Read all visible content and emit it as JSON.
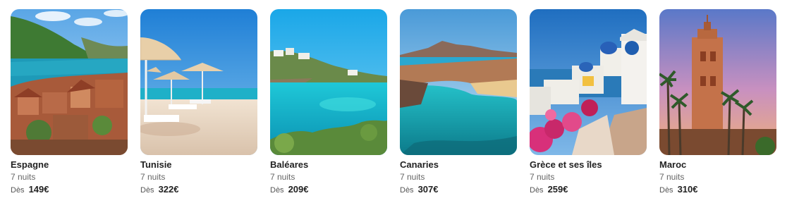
{
  "destinations": [
    {
      "name": "Espagne",
      "nights": "7 nuits",
      "from_label": "Dès",
      "price": "149€",
      "image": "spain-coast-photo"
    },
    {
      "name": "Tunisie",
      "nights": "7 nuits",
      "from_label": "Dès",
      "price": "322€",
      "image": "tunisia-beach-umbrellas-photo"
    },
    {
      "name": "Baléares",
      "nights": "7 nuits",
      "from_label": "Dès",
      "price": "209€",
      "image": "balearic-cove-photo"
    },
    {
      "name": "Canaries",
      "nights": "7 nuits",
      "from_label": "Dès",
      "price": "307€",
      "image": "canary-volcanic-bay-photo"
    },
    {
      "name": "Grèce et ses îles",
      "nights": "7 nuits",
      "from_label": "Dès",
      "price": "259€",
      "image": "greece-santorini-photo"
    },
    {
      "name": "Maroc",
      "nights": "7 nuits",
      "from_label": "Dès",
      "price": "310€",
      "image": "morocco-koutoubia-photo"
    }
  ]
}
